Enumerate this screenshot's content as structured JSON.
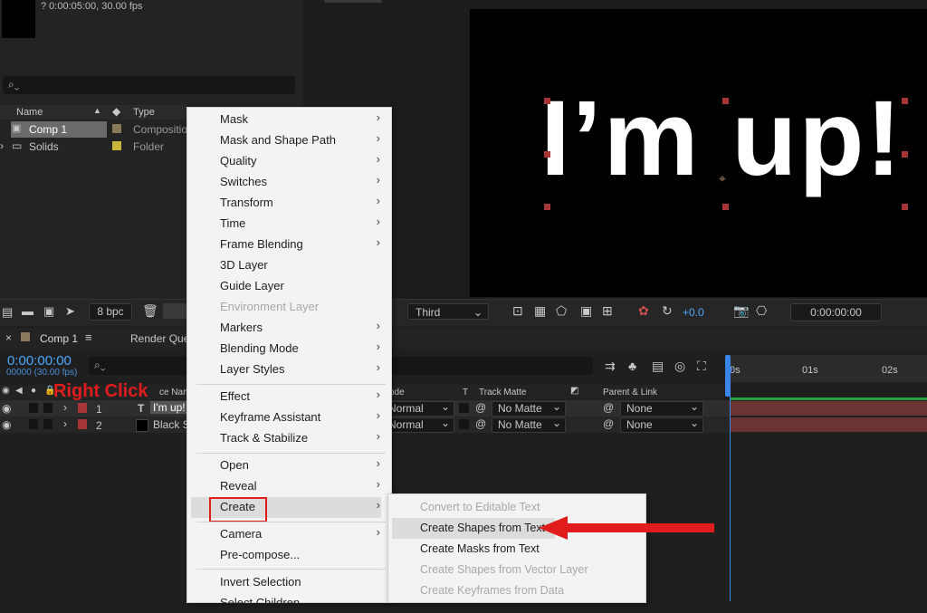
{
  "project": {
    "comp_info": "? 0:00:05:00, 30.00 fps",
    "search_placeholder": "",
    "columns": {
      "name": "Name",
      "type": "Type"
    },
    "items": [
      {
        "name": "Comp 1",
        "type": "Compositio",
        "label_color": "#8a7a5a"
      },
      {
        "name": "Solids",
        "type": "Folder",
        "label_color": "#c7b63b"
      }
    ]
  },
  "viewer": {
    "text": "I’m up!",
    "text_color": "#ffffff",
    "handle_color": "#a83535"
  },
  "toolbar": {
    "bpc": "8 bpc",
    "view": "Third",
    "exposure": "+0.0",
    "timecode": "0:00:00:00"
  },
  "timeline": {
    "tabs": [
      {
        "label": "Comp 1"
      },
      {
        "label": "Render Que"
      }
    ],
    "time": "0:00:00:00",
    "frames": "00000 (30.00 fps)",
    "columns": {
      "source": "ce Name",
      "mode": "ode",
      "t": "T",
      "track_matte": "Track Matte",
      "parent": "Parent & Link"
    },
    "ruler": [
      "0s",
      "01s",
      "02s"
    ],
    "layers": [
      {
        "num": "1",
        "type_icon": "T",
        "name": "I'm up!",
        "mode": "Normal",
        "matte": "No Matte",
        "parent": "None",
        "color": "#a83535"
      },
      {
        "num": "2",
        "type_icon": "",
        "name": "Black S",
        "mode": "Normal",
        "matte": "No Matte",
        "parent": "None",
        "color": "#a83535"
      }
    ]
  },
  "annotation": {
    "right_click": "Right Click"
  },
  "context_menu": {
    "items": [
      {
        "label": "Mask",
        "arrow": "›"
      },
      {
        "label": "Mask and Shape Path",
        "arrow": "›"
      },
      {
        "label": "Quality",
        "arrow": "›"
      },
      {
        "label": "Switches",
        "arrow": "›"
      },
      {
        "label": "Transform",
        "arrow": "›"
      },
      {
        "label": "Time",
        "arrow": "›"
      },
      {
        "label": "Frame Blending",
        "arrow": "›"
      },
      {
        "label": "3D Layer",
        "arrow": ""
      },
      {
        "label": "Guide Layer",
        "arrow": ""
      },
      {
        "label": "Environment Layer",
        "arrow": ""
      },
      {
        "label": "Markers",
        "arrow": "›"
      },
      {
        "label": "Blending Mode",
        "arrow": "›"
      },
      {
        "label": "Layer Styles",
        "arrow": "›"
      },
      {
        "label": "Effect",
        "arrow": "›"
      },
      {
        "label": "Keyframe Assistant",
        "arrow": "›"
      },
      {
        "label": "Track & Stabilize",
        "arrow": "›"
      },
      {
        "label": "Open",
        "arrow": "›"
      },
      {
        "label": "Reveal",
        "arrow": "›"
      },
      {
        "label": "Create",
        "arrow": "›"
      },
      {
        "label": "Camera",
        "arrow": "›"
      },
      {
        "label": "Pre-compose...",
        "arrow": ""
      },
      {
        "label": "Invert Selection",
        "arrow": ""
      },
      {
        "label": "Select Children",
        "arrow": ""
      }
    ]
  },
  "submenu": {
    "items": [
      {
        "label": "Convert to Editable Text"
      },
      {
        "label": "Create Shapes from Text"
      },
      {
        "label": "Create Masks from Text"
      },
      {
        "label": "Create Shapes from Vector Layer"
      },
      {
        "label": "Create Keyframes from Data"
      }
    ]
  },
  "colors": {
    "accent_blue": "#4aa8ff",
    "annotation_red": "#e01c1c",
    "track_green": "#2aa043"
  }
}
